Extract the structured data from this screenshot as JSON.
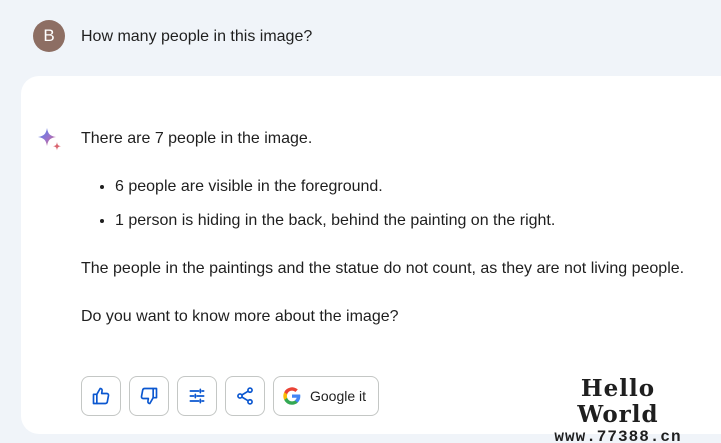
{
  "prompt": {
    "avatar_initial": "B",
    "text": "How many people in this image?"
  },
  "response": {
    "lead": "There are 7 people in the image.",
    "bullets": [
      "6 people are visible in the foreground.",
      "1 person is hiding in the back, behind the painting on the right."
    ],
    "paragraph": "The people in the paintings and the statue do not count, as they are not living people.",
    "question": "Do you want to know more about the image?"
  },
  "actions": {
    "thumbs_up": "thumbs-up-icon",
    "thumbs_down": "thumbs-down-icon",
    "modify": "tune-icon",
    "share": "share-icon",
    "google_label": "Google it"
  },
  "watermark": {
    "title": "Hello World",
    "url": "www.77388.cn"
  },
  "colors": {
    "background": "#f0f4f9",
    "card": "#ffffff",
    "icon_blue": "#0b57d0",
    "avatar": "#8d6e63",
    "border": "#c4c7c5"
  }
}
